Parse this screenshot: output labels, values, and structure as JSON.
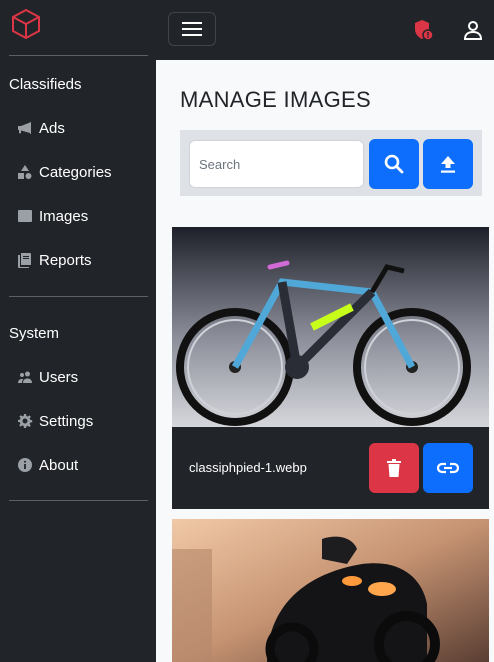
{
  "sidebar": {
    "sections": [
      {
        "heading": "Classifieds",
        "items": [
          {
            "label": "Ads",
            "icon": "megaphone-icon"
          },
          {
            "label": "Categories",
            "icon": "shapes-icon"
          },
          {
            "label": "Images",
            "icon": "image-icon"
          },
          {
            "label": "Reports",
            "icon": "journals-icon"
          }
        ]
      },
      {
        "heading": "System",
        "items": [
          {
            "label": "Users",
            "icon": "people-icon"
          },
          {
            "label": "Settings",
            "icon": "gear-icon"
          },
          {
            "label": "About",
            "icon": "info-circle-icon"
          }
        ]
      }
    ]
  },
  "page": {
    "title": "MANAGE IMAGES"
  },
  "search": {
    "placeholder": "Search",
    "value": ""
  },
  "images": [
    {
      "filename": "classiphpied-1.webp"
    },
    {
      "filename": ""
    }
  ],
  "colors": {
    "sidebar": "#212529",
    "primary": "#0d6efd",
    "danger": "#dc3545",
    "alert": "#dc3545"
  }
}
